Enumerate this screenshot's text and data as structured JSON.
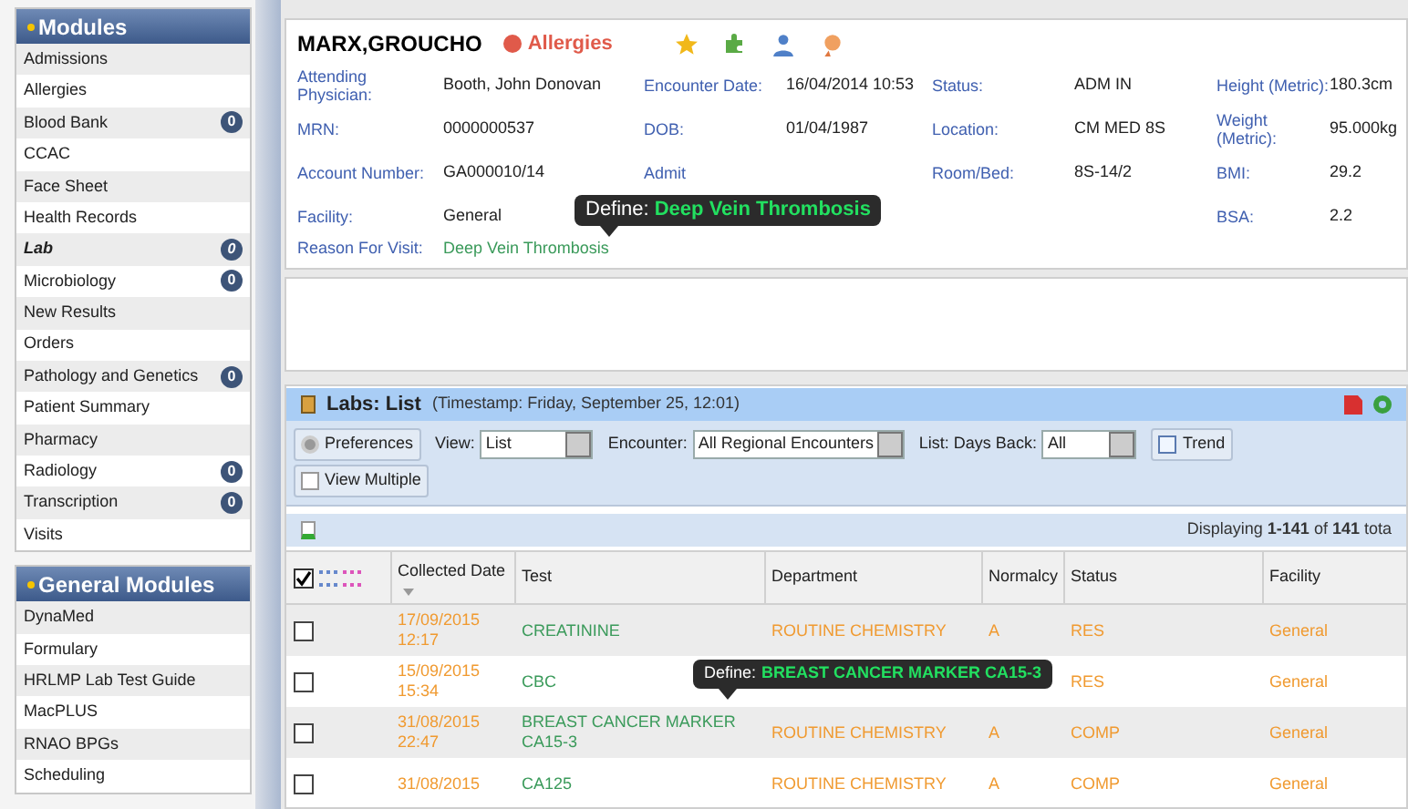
{
  "sidebar": {
    "sections": [
      {
        "title": "Modules",
        "items": [
          {
            "label": "Admissions",
            "selected": false
          },
          {
            "label": "Allergies",
            "selected": false
          },
          {
            "label": "Blood Bank",
            "selected": false,
            "count": "0"
          },
          {
            "label": "CCAC",
            "selected": false
          },
          {
            "label": "Face Sheet",
            "selected": false
          },
          {
            "label": "Health Records",
            "selected": false
          },
          {
            "label": "Lab",
            "selected": true,
            "count": "0"
          },
          {
            "label": "Microbiology",
            "selected": false,
            "count": "0"
          },
          {
            "label": "New Results",
            "selected": false
          },
          {
            "label": "Orders",
            "selected": false
          },
          {
            "label": "Pathology and Genetics",
            "selected": false,
            "count": "0"
          },
          {
            "label": "Patient Summary",
            "selected": false
          },
          {
            "label": "Pharmacy",
            "selected": false
          },
          {
            "label": "Radiology",
            "selected": false,
            "count": "0"
          },
          {
            "label": "Transcription",
            "selected": false,
            "count": "0"
          },
          {
            "label": "Visits",
            "selected": false
          }
        ]
      },
      {
        "title": "General Modules",
        "items": [
          {
            "label": "DynaMed",
            "selected": false
          },
          {
            "label": "Formulary",
            "selected": false
          },
          {
            "label": "HRLMP Lab Test Guide",
            "selected": false
          },
          {
            "label": "MacPLUS",
            "selected": false
          },
          {
            "label": "RNAO BPGs",
            "selected": false
          },
          {
            "label": "Scheduling",
            "selected": false
          }
        ]
      }
    ]
  },
  "patient": {
    "name": "MARX,GROUCHO",
    "alert": "Allergies",
    "field_columns": [
      [
        {
          "label": "Attending Physician:",
          "value": "Booth, John Donovan"
        },
        {
          "label": "MRN:",
          "value": "0000000537"
        },
        {
          "label": "Account Number:",
          "value": "GA000010/14"
        },
        {
          "label": "Facility:",
          "value": "General"
        }
      ],
      [
        {
          "label": "Encounter Date:",
          "value": "16/04/2014 10:53"
        },
        {
          "label": "DOB:",
          "value": "01/04/1987"
        },
        {
          "label": "Admit"
        }
      ],
      [
        {
          "label": "Status:",
          "value": "ADM IN"
        },
        {
          "label": "Location:",
          "value": "CM MED 8S"
        },
        {
          "label": "Room/Bed:",
          "value": "8S-14/2"
        }
      ],
      [
        {
          "label": "Height (Metric):",
          "value": "180.3cm"
        },
        {
          "label": "Weight (Metric):",
          "value": "95.000kg"
        },
        {
          "label": "BMI:",
          "value": "29.2"
        },
        {
          "label": "BSA:",
          "value": "2.2"
        }
      ]
    ],
    "reason_label": "Reason For Visit:",
    "reason": "Deep Vein Thrombosis",
    "tooltip": {
      "prefix": "Define:",
      "term": "Deep Vein Thrombosis"
    }
  },
  "labs": {
    "title": "Labs: List",
    "timestamp": "(Timestamp: Friday, September 25, 12:01)",
    "toolbar": {
      "preferences": "Preferences",
      "view_label": "View:",
      "view": "List",
      "encounter_label": "Encounter:",
      "encounter": "All Regional Encounters",
      "days_label": "List: Days Back:",
      "days": "All",
      "trend": "Trend",
      "view_multiple": "View Multiple"
    },
    "displaying": "Displaying **1-141** of **141** tota",
    "columns": [
      "Collected Date",
      "Test",
      "Department",
      "Normalcy",
      "Status",
      "Facility"
    ],
    "select_all_checked": true,
    "rows": [
      {
        "checked": false,
        "date": "17/09/2015 12:17",
        "test": "CREATININE",
        "department": "ROUTINE CHEMISTRY",
        "normalcy": "A",
        "status": "RES",
        "facility": "General"
      },
      {
        "checked": false,
        "date": "15/09/2015 15:34",
        "test": "CBC",
        "status": "RES",
        "facility": "General"
      },
      {
        "checked": false,
        "date": "31/08/2015 22:47",
        "test": "BREAST CANCER MARKER CA15-3",
        "department": "ROUTINE CHEMISTRY",
        "normalcy": "A",
        "status": "COMP",
        "facility": "General"
      },
      {
        "checked": false,
        "date": "31/08/2015",
        "test": "CA125",
        "department": "ROUTINE CHEMISTRY",
        "normalcy": "A",
        "status": "COMP",
        "facility": "General"
      }
    ],
    "tooltip": {
      "prefix": "Define:",
      "term": "BREAST CANCER MARKER CA15-3"
    }
  }
}
